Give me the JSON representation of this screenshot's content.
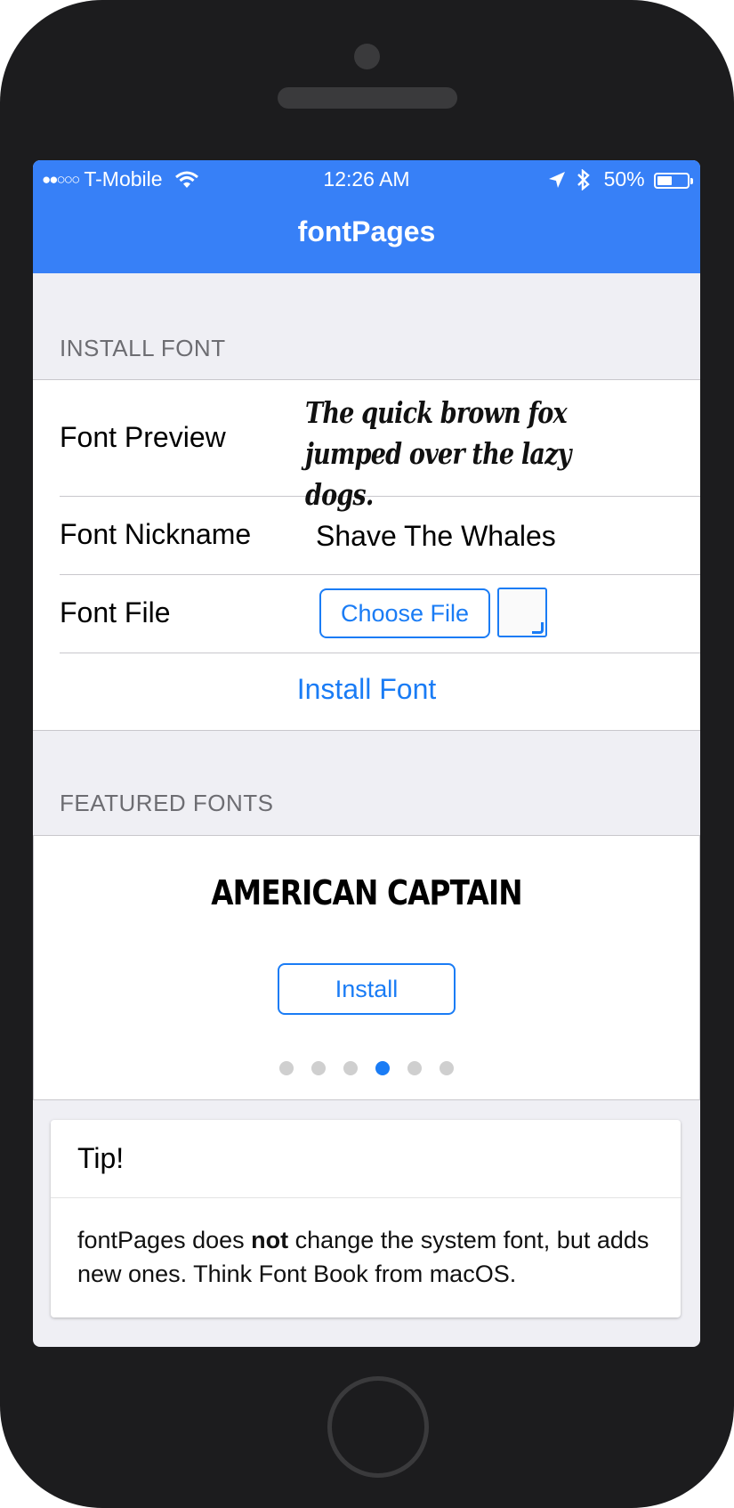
{
  "status_bar": {
    "signal": "●●○○○",
    "carrier": "T-Mobile",
    "time": "12:26 AM",
    "battery": "50%",
    "battery_level": 0.5
  },
  "nav": {
    "title": "fontPages"
  },
  "install_section": {
    "header": "INSTALL FONT",
    "preview_label": "Font Preview",
    "preview_text": "The quick brown fox jumped over the lazy dogs.",
    "nickname_label": "Font Nickname",
    "nickname_value": "Shave The Whales",
    "file_label": "Font File",
    "choose_file": "Choose File",
    "install_button": "Install Font"
  },
  "featured_section": {
    "header": "FEATURED FONTS",
    "font_name": "AMERICAN CAPTAIN",
    "install_button": "Install",
    "page_count": 6,
    "active_page": 3
  },
  "tip": {
    "title": "Tip!",
    "body_pre": "fontPages does ",
    "body_bold": "not",
    "body_post": " change the system font, but adds new ones. Think Font Book from macOS."
  },
  "colors": {
    "accent": "#1a7cf5",
    "nav_bg": "#3780f7",
    "background": "#efeff4"
  }
}
